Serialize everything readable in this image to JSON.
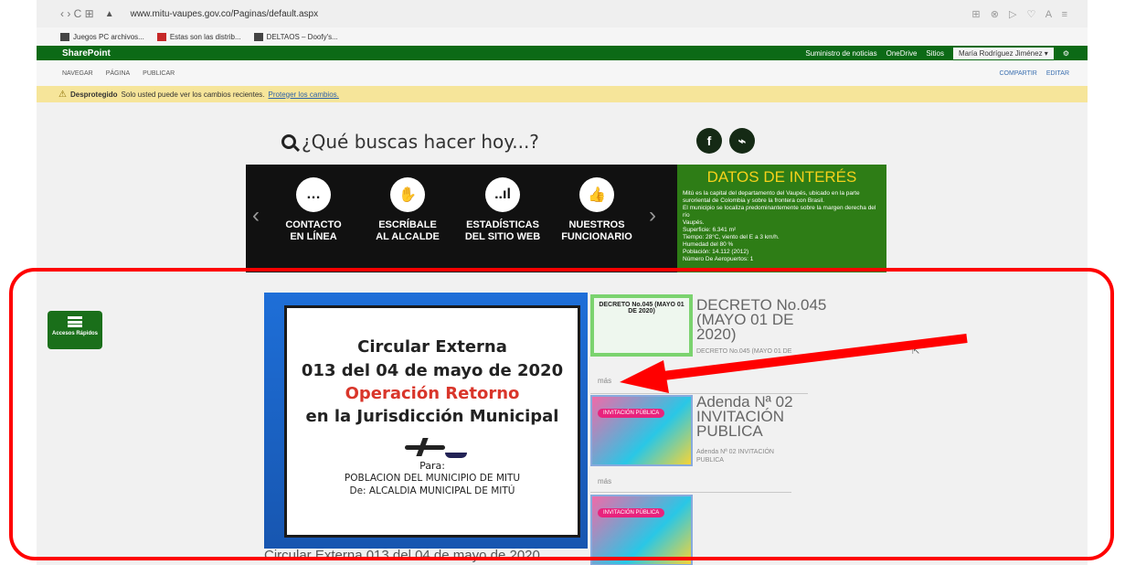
{
  "browser": {
    "nav_buttons": "‹  ›  C  ⊞",
    "url": "www.mitu-vaupes.gov.co/Paginas/default.aspx",
    "bookmarks": [
      "Juegos PC archivos...",
      "Estas son las distrib...",
      "DELTAOS – Doofy's..."
    ]
  },
  "sharepoint": {
    "brand": "SharePoint",
    "links": [
      "Suministro de noticias",
      "OneDrive",
      "Sitios"
    ],
    "user": "María Rodríguez Jiménez ▾",
    "ribbon_tabs": [
      "NAVEGAR",
      "PÁGINA",
      "PUBLICAR"
    ],
    "share": "COMPARTIR",
    "edit": "EDITAR"
  },
  "warning": {
    "strong": "Desprotegido",
    "text": "Solo usted puede ver los cambios recientes.",
    "link": "Proteger los cambios."
  },
  "search": {
    "placeholder": "¿Qué buscas hacer hoy...?"
  },
  "social": {
    "facebook": "f",
    "rss": "⌁"
  },
  "menu": [
    {
      "line1": "CONTACTO",
      "line2": "EN LÍNEA",
      "icon": "chat-icon",
      "glyph": "…"
    },
    {
      "line1": "ESCRÍBALE",
      "line2": "AL ALCALDE",
      "icon": "hand-icon",
      "glyph": "✋"
    },
    {
      "line1": "ESTADÍSTICAS",
      "line2": "DEL SITIO WEB",
      "icon": "bar-chart-icon",
      "glyph": "..ıl"
    },
    {
      "line1": "NUESTROS",
      "line2": "FUNCIONARIO",
      "icon": "thumbs-up-icon",
      "glyph": "👍"
    }
  ],
  "datos": {
    "title": "DATOS DE INTERÉS",
    "lines": [
      "Mitú es la capital del departamento del Vaupés, ubicado en la parte",
      "suroriental de Colombia y sobre la frontera con Brasil.",
      "El municipio se localiza predominantemente sobre la margen derecha del río",
      "Vaupés.",
      "Superficie: 6.341 m²",
      "Tiempo: 28°C, viento del E a 3 km/h.",
      "Humedad del 80 %",
      "Población: 14.112 (2012)",
      "Número De Aeropuertos: 1"
    ]
  },
  "quick_access": {
    "label": "Accesos Rápidos"
  },
  "circular": {
    "line1": "Circular Externa",
    "line2": "013 del 04 de mayo de 2020",
    "line3": "Operación Retorno",
    "line4": "en la Jurisdicción Municipal",
    "para": "Para:",
    "poblacion": "POBLACION DEL MUNICIPIO DE MITU",
    "de": "De: ALCALDIA MUNICIPAL DE MITÚ",
    "caption": "Circular Externa 013 del 04 de mayo de 2020"
  },
  "news": [
    {
      "thumb_title": "DECRETO No.045 (MAYO 01 DE 2020)",
      "title_lines": [
        "DECRETO No.045",
        "(MAYO 01 DE",
        "2020)"
      ],
      "sub": "DECRETO No.045 (MAYO 01 DE",
      "more": "más"
    },
    {
      "thumb_label": "INVITACIÓN PÚBLICA",
      "title_lines": [
        "Adenda Nª 02",
        "INVITACIÓN",
        "PUBLICA"
      ],
      "sub_lines": [
        "Adenda Nª 02 INVITACIÓN",
        "PUBLICA"
      ],
      "more": "más"
    },
    {
      "thumb_label": "INVITACIÓN PÚBLICA"
    }
  ],
  "colors": {
    "sharepoint_green": "#0c6a16",
    "warning_yellow": "#f6e59a",
    "datos_green": "#2e7d16",
    "datos_title": "#f5d11b",
    "circular_blue": "#1e6fd8",
    "annotation_red": "#ff0000"
  }
}
